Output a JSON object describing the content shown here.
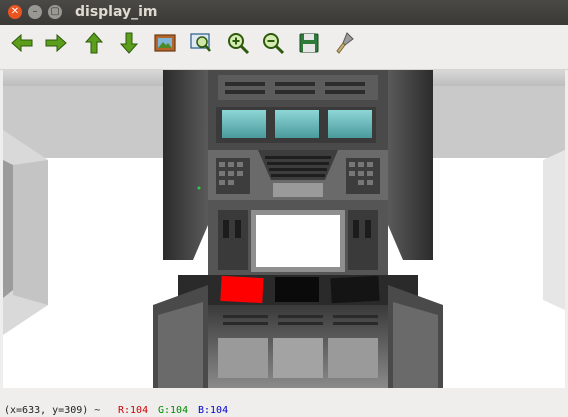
{
  "window": {
    "title": "display_im"
  },
  "toolbar": {
    "buttons": [
      {
        "name": "pan-left",
        "icon": "arrow-left-icon"
      },
      {
        "name": "pan-right",
        "icon": "arrow-right-icon"
      },
      {
        "name": "pan-up",
        "icon": "arrow-up-icon"
      },
      {
        "name": "pan-down",
        "icon": "arrow-down-icon"
      },
      {
        "name": "reset-view",
        "icon": "image-icon"
      },
      {
        "name": "zoom-to-rect",
        "icon": "zoom-rect-icon"
      },
      {
        "name": "zoom-in",
        "icon": "zoom-in-icon"
      },
      {
        "name": "zoom-out",
        "icon": "zoom-out-icon"
      },
      {
        "name": "save",
        "icon": "floppy-icon"
      },
      {
        "name": "properties",
        "icon": "brush-icon"
      }
    ]
  },
  "status": {
    "coords": "(x=633, y=309) ~",
    "r": "R:104",
    "g": "G:104",
    "b": "B:104",
    "colors": {
      "r": "#cc0000",
      "g": "#008800",
      "b": "#0000cc"
    }
  }
}
